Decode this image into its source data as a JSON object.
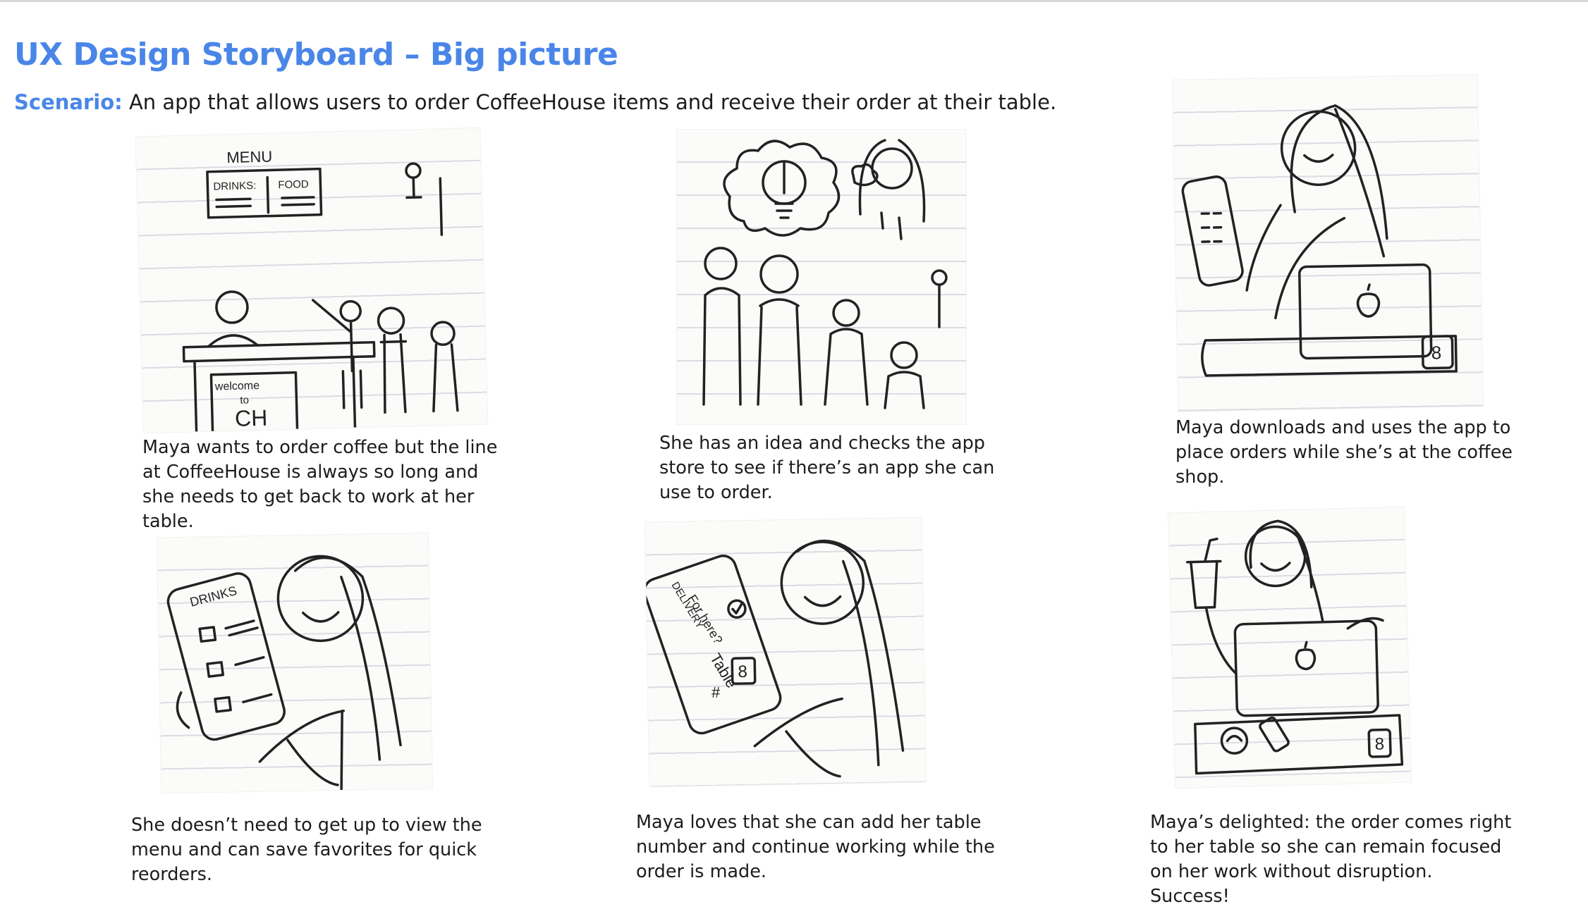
{
  "title": "UX Design Storyboard – Big picture",
  "scenario": {
    "label": "Scenario:",
    "text": "An app that allows users to order CoffeeHouse items and receive their order at their table."
  },
  "panels": [
    {
      "caption": "Maya wants to order coffee but the line at CoffeeHouse is always so long and she needs to get back to work at her table.",
      "sketch_text": {
        "menu": "MENU",
        "drinks": "DRINKS:",
        "food": "FOOD",
        "welcome": "welcome",
        "to": "to",
        "ch": "CH"
      }
    },
    {
      "caption": "She has an idea and checks the app store to see if there’s an app she can use to order."
    },
    {
      "caption": "Maya downloads and uses the app to place orders while she’s at the coffee shop.",
      "sketch_text": {
        "table_number": "8"
      }
    },
    {
      "caption": "She doesn’t need to get up to view the menu and can save favorites for quick reorders.",
      "sketch_text": {
        "drinks": "DRINKS"
      }
    },
    {
      "caption": "Maya loves that she can add her table number and continue working while the order is made.",
      "sketch_text": {
        "delivery": "DELIVERY",
        "for_here": "For here?",
        "table": "Table",
        "hash": "#",
        "table_number": "8"
      }
    },
    {
      "caption": "Maya’s delighted: the order comes right to her table so she can remain focused on her work without disruption. Success!",
      "sketch_text": {
        "table_number": "8"
      }
    }
  ]
}
